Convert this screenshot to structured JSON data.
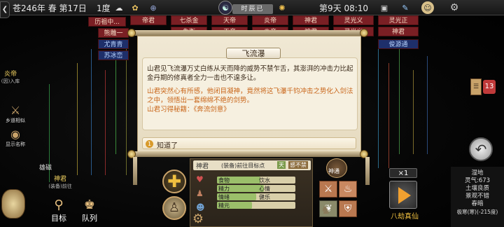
{
  "topbar": {
    "date": "苍246年 春 第17日",
    "weather_level": "1度",
    "era_banner": "时辰已",
    "day_time": "第9天 08:10"
  },
  "grid": {
    "row1": [
      "帝君",
      "七杀金",
      "天帝",
      "炎帝",
      "神君",
      "灵光义",
      "灵光正"
    ],
    "row2": [
      "朱衡",
      "天帝",
      "炎帝",
      "神君",
      "灵光义"
    ],
    "left_names": [
      "历祖中...",
      "熊雕一",
      "尤青青",
      "苏冰峦"
    ],
    "right_names": [
      "神君",
      "俊源通"
    ]
  },
  "left": {
    "name_top": "炎帝",
    "name_top_sub": "(因)入库",
    "btn_follow": "乡道相似",
    "btn_display": "显示名称",
    "name_bottom_1": "雄磁",
    "name_bottom_2": "神君",
    "name_bottom_2_sub": "(装备)前往"
  },
  "dialog": {
    "title": "飞流瀑",
    "paragraph1": "山君见飞流瀑万丈白练从天而降的威势不禁乍舌，其澎湃的冲击力比起金丹期的修真者全力一击也不遑多让。",
    "paragraph2": "山君突然心有所感，他闭目凝神，竟然将这飞瀑千钧冲击之势化入剑法之中，领悟出一套绵绵不绝的剑势。",
    "paragraph3": "山君习得秘籍：《奔流剑意》",
    "option_number": "1",
    "option_label": "知道了"
  },
  "char_panel": {
    "name": "神君",
    "action": "(装备)前往目标点",
    "tag1": "天",
    "tag2": "感不禁",
    "stats": [
      {
        "label": "食物",
        "value_label": "饮水",
        "fill": 0.55
      },
      {
        "label": "精力",
        "value_label": "心情",
        "fill": 0.6
      },
      {
        "label": "情绪",
        "value_label": "健乐",
        "fill": 0.5
      },
      {
        "label": "精元",
        "value_label": "",
        "fill": 0.45
      }
    ]
  },
  "right": {
    "badge_count": "13",
    "speed": "×1",
    "play_label": "八劫真仙",
    "god_label": "神通"
  },
  "info_box": {
    "line1": "湿地",
    "line2": "灵气:673",
    "line3": "土壤良质",
    "line4": "景观不错",
    "line5": "春暗",
    "line6": "极寒(寒)(-215度)"
  },
  "bottom_left": {
    "goal": "目标",
    "team": "队列"
  },
  "colors": {
    "accent_gold": "#d89a2a",
    "grid_red": "#7a1f24",
    "grid_blue": "#1e2f6a",
    "dialog_bg": "#f0e8d4",
    "highlight_orange": "#c9661a"
  }
}
